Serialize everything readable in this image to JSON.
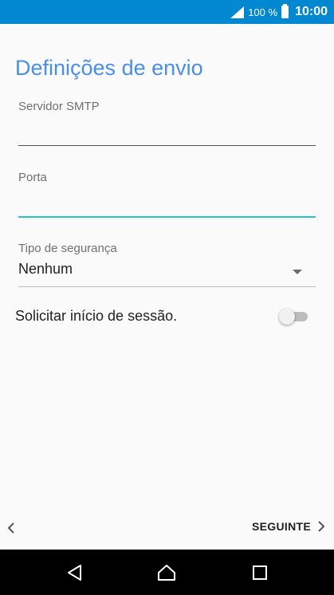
{
  "status_bar": {
    "battery_percent": "100 %",
    "time": "10:00",
    "icons": [
      "signal-icon",
      "battery-icon"
    ],
    "bar_color": "#0288d1"
  },
  "screen": {
    "title": "Definições de envio",
    "title_color": "#4a8ee8"
  },
  "smtp_server": {
    "label": "Servidor SMTP",
    "value": ""
  },
  "port": {
    "label": "Porta",
    "value": "",
    "focused": true,
    "focus_color": "#26c6c6"
  },
  "security": {
    "label": "Tipo de segurança",
    "selected": "Nenhum"
  },
  "require_login": {
    "label": "Solicitar início de sessão.",
    "enabled": false
  },
  "footer": {
    "back_icon": "chevron-left-icon",
    "next_label": "SEGUINTE",
    "next_icon": "chevron-right-icon"
  },
  "nav_bar": {
    "buttons": [
      "back-triangle-icon",
      "home-icon",
      "recents-icon"
    ]
  }
}
